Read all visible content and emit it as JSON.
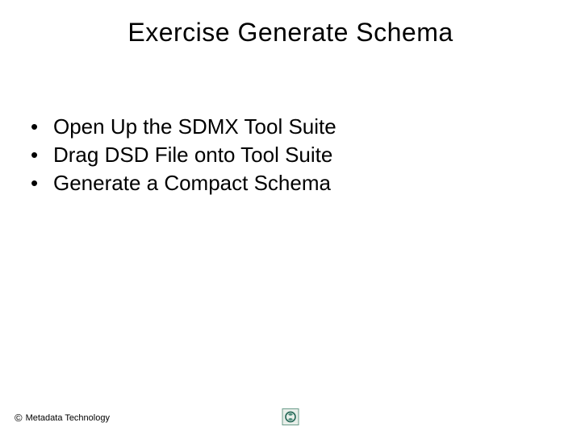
{
  "slide": {
    "title": "Exercise Generate Schema",
    "bullets": [
      "Open Up the SDMX Tool Suite",
      "Drag DSD File onto Tool Suite",
      "Generate a Compact Schema"
    ]
  },
  "footer": {
    "copyright_symbol": "©",
    "text": "Metadata Technology"
  }
}
